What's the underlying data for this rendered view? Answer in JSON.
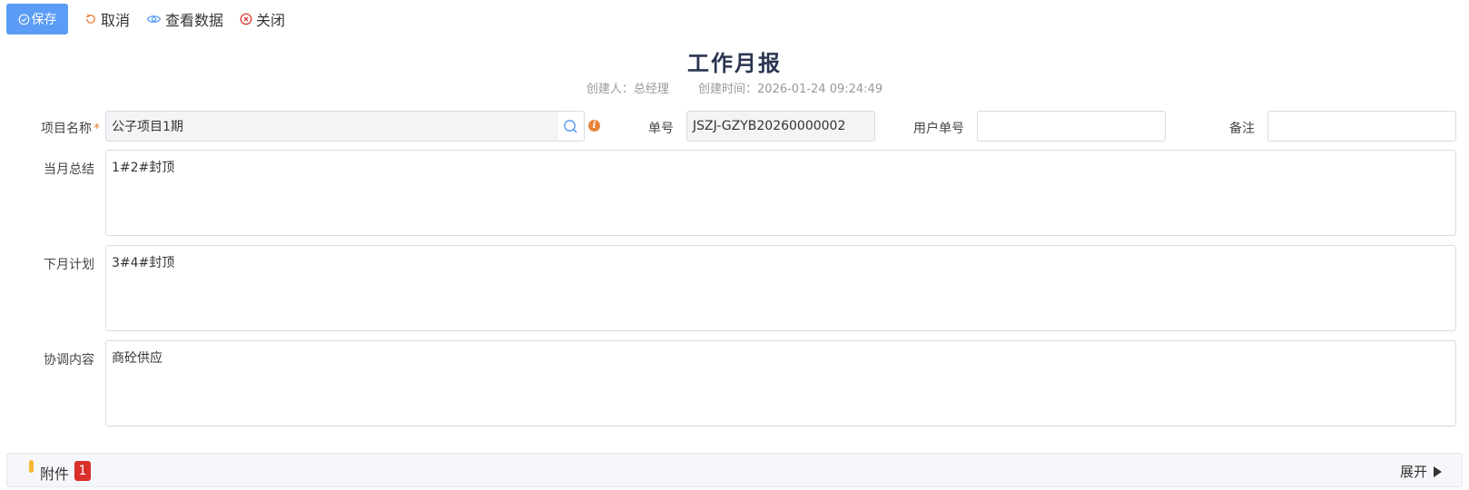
{
  "toolbar": {
    "save_label": "保存",
    "cancel_label": "取消",
    "view_data_label": "查看数据",
    "close_label": "关闭"
  },
  "header": {
    "title": "工作月报",
    "creator": "创建人：总经理",
    "created_time": "创建时间：2026-01-24 09:24:49"
  },
  "form": {
    "project_name_label": "项目名称",
    "project_name_required": "*",
    "project_name_value": "公子项目1期",
    "order_no_label": "单号",
    "order_no_value": "JSZJ-GZYB20260000002",
    "user_order_no_label": "用户单号",
    "user_order_no_value": "",
    "remark_label": "备注",
    "remark_value": "",
    "month_summary_label": "当月总结",
    "month_summary_value": "1#2#封顶",
    "next_month_plan_label": "下月计划",
    "next_month_plan_value": "3#4#封顶",
    "coordination_label": "协调内容",
    "coordination_value": "商砼供应"
  },
  "attachment": {
    "label": "附件",
    "count": "1",
    "expand_label": "展开"
  },
  "colors": {
    "primary": "#5b9cf6",
    "accent_orange": "#e8833a",
    "badge_red": "#d9302c",
    "title": "#2b3552"
  },
  "icons": {
    "save": "check-circle-icon",
    "cancel": "refresh-icon",
    "view_data": "eye-icon",
    "close": "close-circle-icon",
    "search": "search-icon",
    "info": "info-icon",
    "expand": "caret-right-icon"
  }
}
